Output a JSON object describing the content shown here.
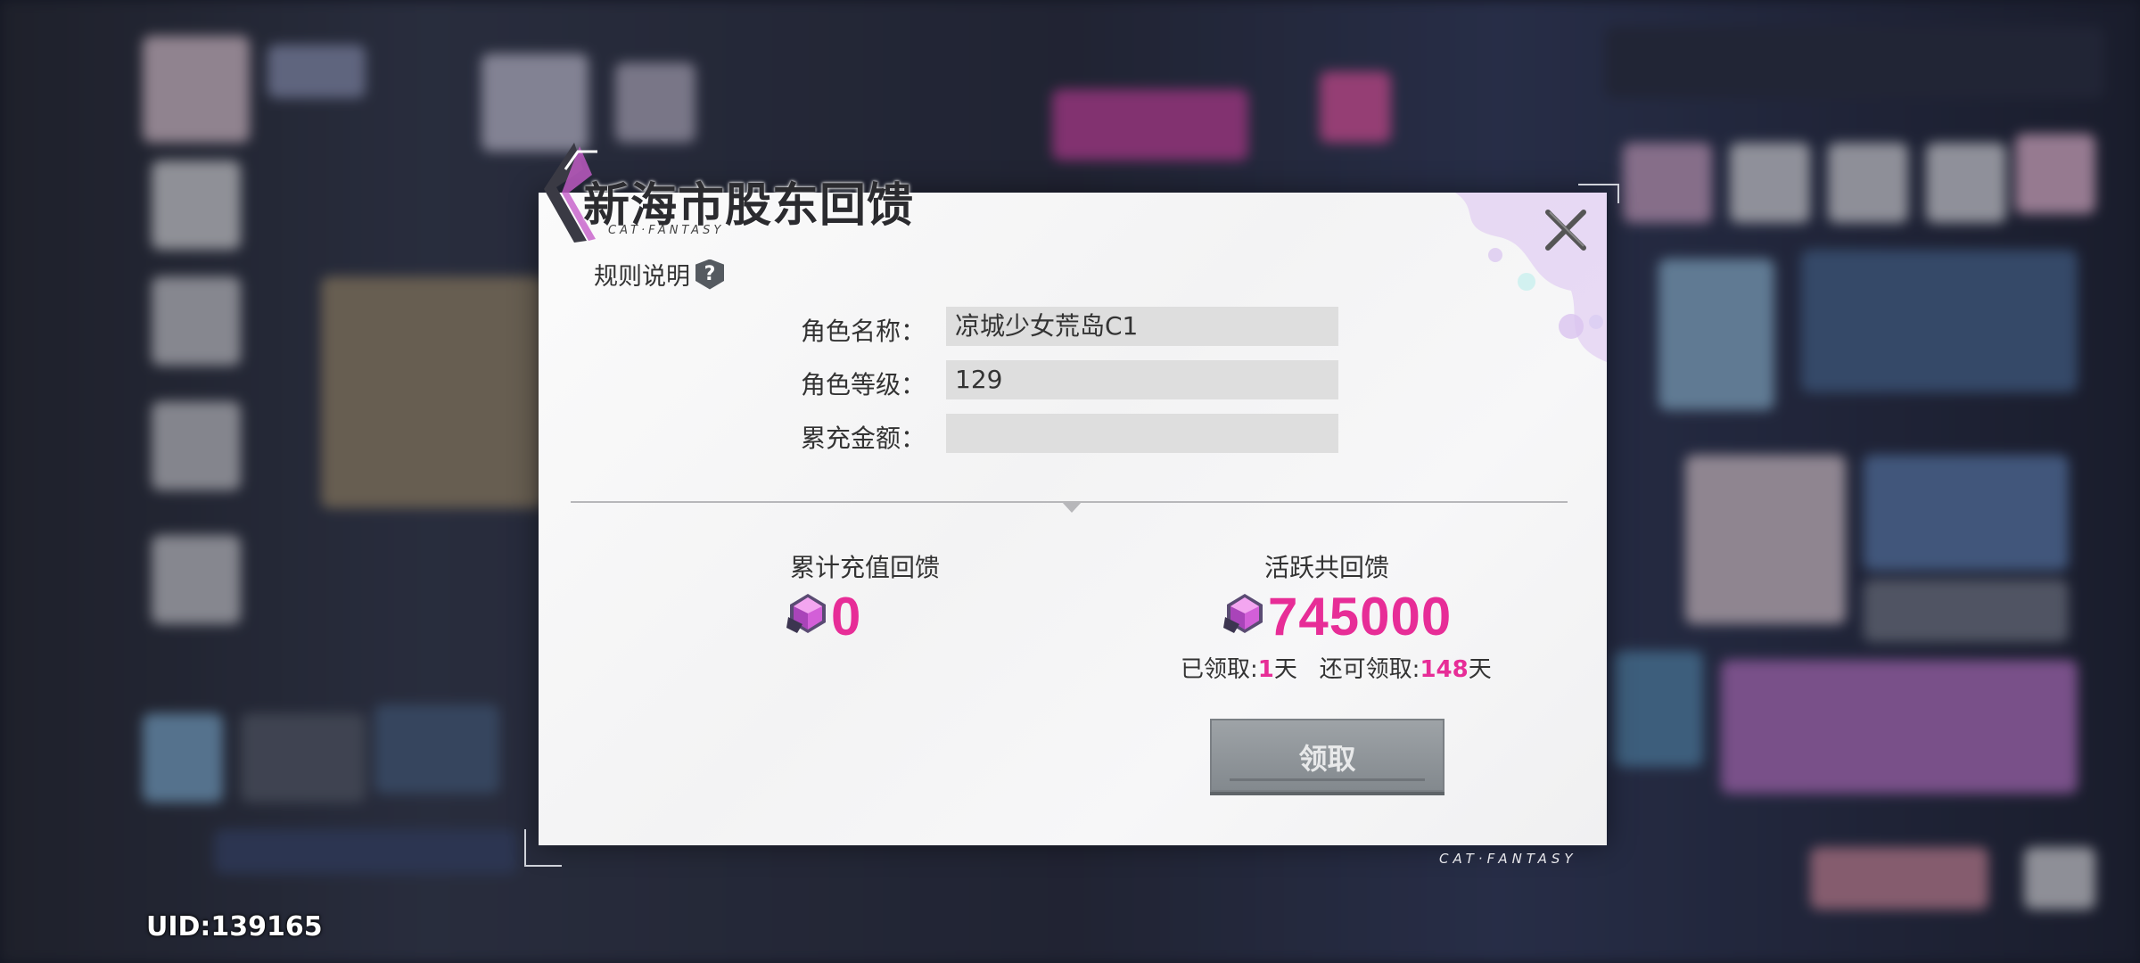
{
  "dialog": {
    "title": "新海市股东回馈",
    "subtitle": "CAT·FANTASY",
    "rules_label": "规则说明",
    "rules_icon": "?",
    "fields": [
      {
        "label": "角色名称：",
        "value": "凉城少女荒岛C1"
      },
      {
        "label": "角色等级：",
        "value": "129"
      },
      {
        "label": "累充金额：",
        "value": ""
      }
    ],
    "recharge_reward": {
      "title": "累计充值回馈",
      "amount": "0"
    },
    "active_reward": {
      "title": "活跃共回馈",
      "amount": "745000",
      "claimed_label": "已领取:",
      "claimed_days": "1",
      "remaining_label": "还可领取:",
      "remaining_days": "148",
      "day_unit": "天"
    },
    "claim_button": "领取"
  },
  "brand_footer": "CAT·FANTASY",
  "uid": "UID:139165",
  "colors": {
    "accent": "#e72d97",
    "dialog_bg": "#f5f5f6",
    "button": "#8f9499"
  },
  "icons": [
    "close-icon",
    "gem-icon",
    "help-icon",
    "logo-icon"
  ]
}
